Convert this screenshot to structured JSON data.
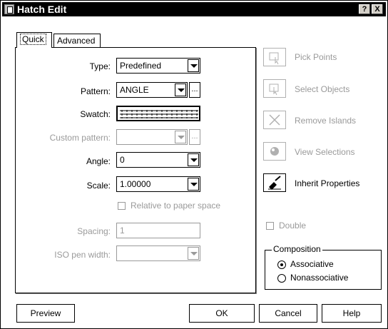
{
  "window": {
    "title": "Hatch Edit",
    "help": "?",
    "close": "X"
  },
  "tabs": [
    {
      "label": "Quick"
    },
    {
      "label": "Advanced"
    }
  ],
  "form": {
    "type": {
      "label": "Type:",
      "value": "Predefined"
    },
    "pattern": {
      "label": "Pattern:",
      "value": "ANGLE",
      "browse": "..."
    },
    "swatch": {
      "label": "Swatch:"
    },
    "custom_pattern": {
      "label": "Custom pattern:",
      "browse": "..."
    },
    "angle": {
      "label": "Angle:",
      "value": "0"
    },
    "scale": {
      "label": "Scale:",
      "value": "1.00000"
    },
    "relative": {
      "label": "Relative to paper space",
      "checked": false
    },
    "spacing": {
      "label": "Spacing:",
      "value": "1"
    },
    "iso": {
      "label": "ISO pen width:"
    }
  },
  "side": {
    "pick_points": "Pick Points",
    "select_objects": "Select Objects",
    "remove_islands": "Remove Islands",
    "view_selections": "View Selections",
    "inherit_properties": "Inherit Properties",
    "double": "Double"
  },
  "composition": {
    "title": "Composition",
    "associative": "Associative",
    "nonassociative": "Nonassociative",
    "selected": "Associative"
  },
  "buttons": {
    "preview": "Preview",
    "ok": "OK",
    "cancel": "Cancel",
    "help": "Help"
  },
  "icons": [
    "pick-points-icon",
    "select-objects-icon",
    "remove-islands-icon",
    "view-selections-icon",
    "inherit-properties-icon"
  ]
}
